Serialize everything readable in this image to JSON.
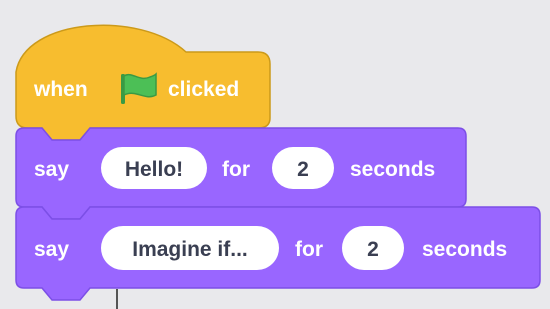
{
  "colors": {
    "canvas_background": "#e9e9ec",
    "event_block_fill": "#f7bd2f",
    "event_block_stroke": "#cc9a1a",
    "looks_block_fill": "#9966ff",
    "looks_block_stroke": "#7c4fe6",
    "input_fill": "#ffffff",
    "input_text": "#3a3f52",
    "flag_green": "#4cbf56"
  },
  "script": {
    "hat_block": {
      "word_before": "when",
      "flag_icon": "green-flag-icon",
      "word_after": "clicked"
    },
    "say_block_1": {
      "verb": "say",
      "message": "Hello!",
      "for_label": "for",
      "seconds_value": "2",
      "seconds_label": "seconds"
    },
    "say_block_2": {
      "verb": "say",
      "message": "Imagine if...",
      "for_label": "for",
      "seconds_value": "2",
      "seconds_label": "seconds"
    }
  }
}
